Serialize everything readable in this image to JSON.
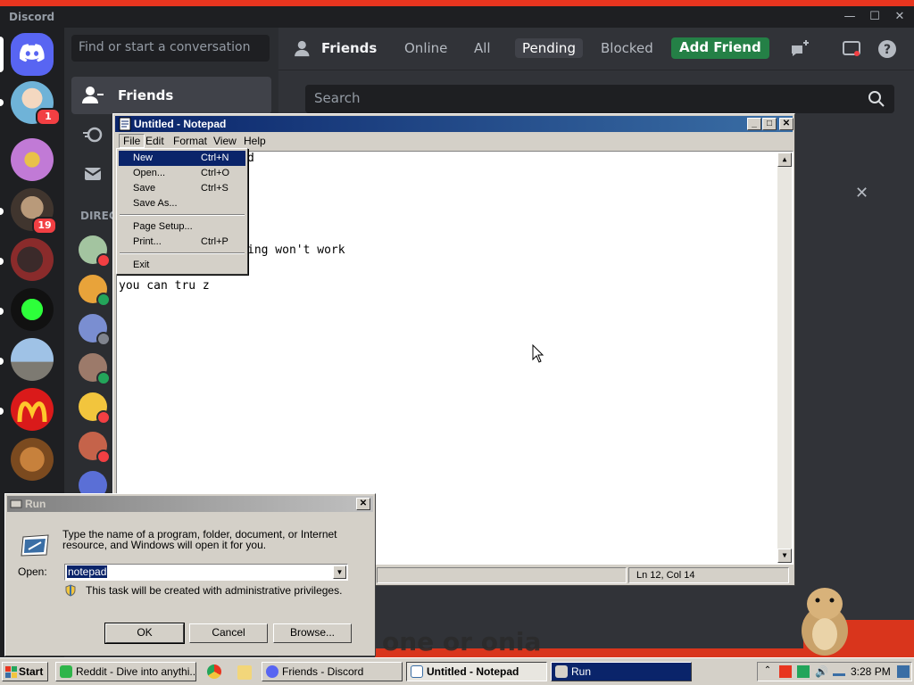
{
  "discord": {
    "brand": "Discord",
    "search_placeholder": "Find or start a conversation",
    "nav_friends": "Friends",
    "direct_messages_label": "DIREC",
    "server_badges": [
      "1",
      "19"
    ],
    "header": {
      "friends": "Friends",
      "tabs": [
        "Online",
        "All",
        "Pending",
        "Blocked"
      ],
      "active_tab": "Pending",
      "add_friend": "Add Friend"
    },
    "main_search_placeholder": "Search",
    "banner_text": "one or onia",
    "colors": {
      "blurple": "#5865f2",
      "green": "#248046",
      "red": "#f23f43"
    }
  },
  "notepad": {
    "title": "Untitled - Notepad",
    "menu": [
      "File",
      "Edit",
      "Format",
      "View",
      "Help"
    ],
    "lines": [
      "d",
      "",
      "",
      "",
      "",
      "",
      "ing won't work",
      "",
      "you can tru z"
    ],
    "status": "Ln 12, Col 14",
    "file_menu": [
      {
        "label": "New",
        "shortcut": "Ctrl+N"
      },
      {
        "label": "Open...",
        "shortcut": "Ctrl+O"
      },
      {
        "label": "Save",
        "shortcut": "Ctrl+S"
      },
      {
        "label": "Save As...",
        "shortcut": ""
      },
      {
        "label": "Page Setup...",
        "shortcut": ""
      },
      {
        "label": "Print...",
        "shortcut": "Ctrl+P"
      },
      {
        "label": "Exit",
        "shortcut": ""
      }
    ]
  },
  "run": {
    "title": "Run",
    "description": "Type the name of a program, folder, document, or Internet resource, and Windows will open it for you.",
    "open_label": "Open:",
    "value": "notepad",
    "admin_note": "This task will be created with administrative privileges.",
    "ok": "OK",
    "cancel": "Cancel",
    "browse": "Browse..."
  },
  "taskbar": {
    "start": "Start",
    "tasks": [
      "Reddit - Dive into anythi...",
      "Friends - Discord",
      "Untitled - Notepad",
      "Run"
    ],
    "time": "3:28 PM"
  }
}
